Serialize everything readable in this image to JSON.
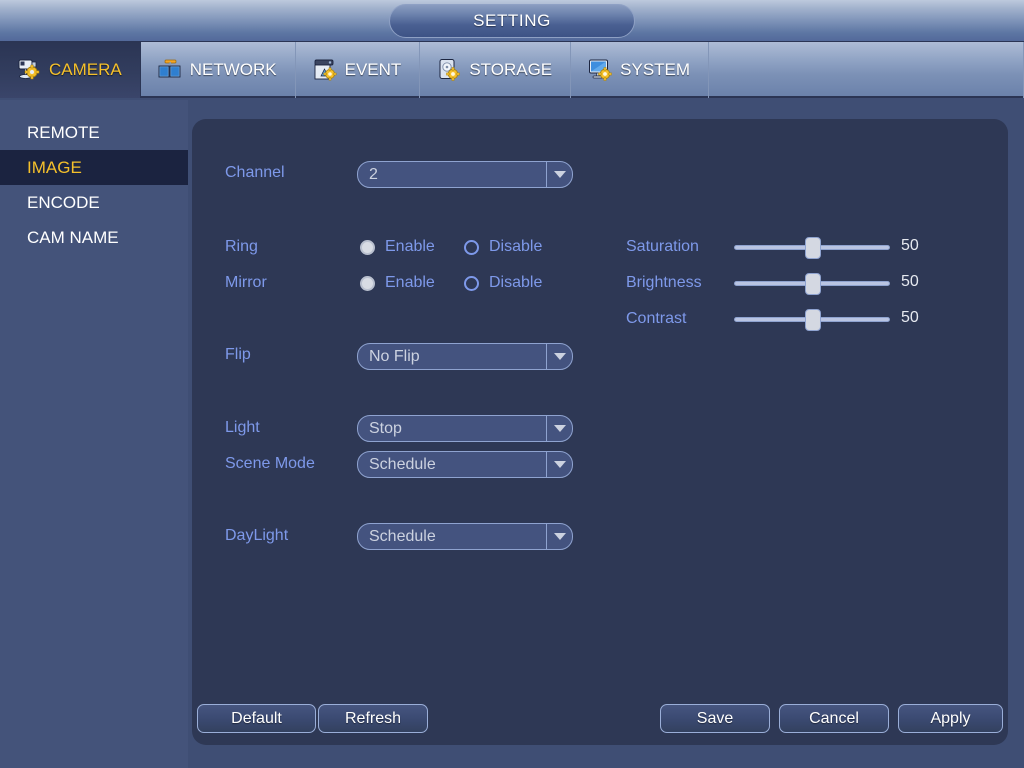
{
  "window": {
    "title": "SETTING"
  },
  "tabs": [
    {
      "label": "CAMERA",
      "icon": "camera-gear-icon",
      "active": true
    },
    {
      "label": "NETWORK",
      "icon": "network-icon",
      "active": false
    },
    {
      "label": "EVENT",
      "icon": "event-gear-icon",
      "active": false
    },
    {
      "label": "STORAGE",
      "icon": "hdd-gear-icon",
      "active": false
    },
    {
      "label": "SYSTEM",
      "icon": "monitor-gear-icon",
      "active": false
    }
  ],
  "sidebar": {
    "items": [
      {
        "label": "REMOTE",
        "active": false
      },
      {
        "label": "IMAGE",
        "active": true
      },
      {
        "label": "ENCODE",
        "active": false
      },
      {
        "label": "CAM NAME",
        "active": false
      }
    ]
  },
  "form": {
    "channel": {
      "label": "Channel",
      "value": "2"
    },
    "ring": {
      "label": "Ring",
      "enable_label": "Enable",
      "disable_label": "Disable",
      "value": "Enable"
    },
    "mirror": {
      "label": "Mirror",
      "enable_label": "Enable",
      "disable_label": "Disable",
      "value": "Enable"
    },
    "flip": {
      "label": "Flip",
      "value": "No Flip"
    },
    "light": {
      "label": "Light",
      "value": "Stop"
    },
    "scene_mode": {
      "label": "Scene Mode",
      "value": "Schedule"
    },
    "daylight": {
      "label": "DayLight",
      "value": "Schedule"
    },
    "saturation": {
      "label": "Saturation",
      "value": "50",
      "min": 0,
      "max": 100
    },
    "brightness": {
      "label": "Brightness",
      "value": "50",
      "min": 0,
      "max": 100
    },
    "contrast": {
      "label": "Contrast",
      "value": "50",
      "min": 0,
      "max": 100
    }
  },
  "buttons": {
    "default": "Default",
    "refresh": "Refresh",
    "save": "Save",
    "cancel": "Cancel",
    "apply": "Apply"
  },
  "colors": {
    "accent_active": "#f5c02b",
    "label_blue": "#7e99ea",
    "panel_bg": "#2e3855",
    "sidebar_bg": "#44537a",
    "sidebar_active_bg": "#1b2340"
  }
}
